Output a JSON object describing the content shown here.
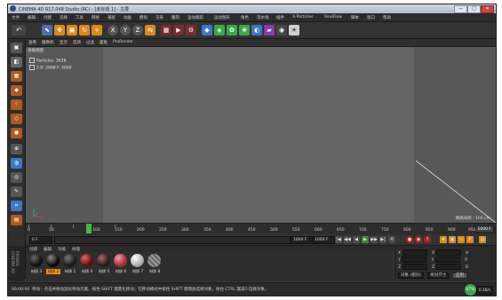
{
  "window": {
    "title": "CINEMA 4D R17.048 Studio (RC) - [未标题 1] - 主要",
    "controls": {
      "minimize": "—",
      "maximize": "□",
      "close": "✕"
    }
  },
  "menubar": [
    "文件",
    "编辑",
    "创建",
    "选择",
    "工具",
    "网格",
    "捕捉",
    "动画",
    "模拟",
    "渲染",
    "雕刻",
    "运动跟踪",
    "运动图形",
    "角色",
    "流水线",
    "插件",
    "X-Particles",
    "RealFlow",
    "脚本",
    "窗口",
    "帮助"
  ],
  "toolbar": {
    "undo": "↶",
    "move": "✥",
    "scale": "▣",
    "rotate": "↻",
    "add": "+",
    "x_axis": "X",
    "y_axis": "Y",
    "z_axis": "Z",
    "coord": "⇆"
  },
  "viewport": {
    "menu": [
      "查看",
      "摄像机",
      "显示",
      "选项",
      "过滤",
      "面板",
      "ProRender"
    ],
    "label": "透视视图",
    "hud": [
      {
        "label": "Particles: 3628"
      },
      {
        "label": "2.0: 2908 F: 5000"
      }
    ],
    "grid_spacing": "网格间距 : 100 cm"
  },
  "timeline": {
    "ticks": [
      "0",
      "50",
      "100",
      "150",
      "200",
      "250",
      "300",
      "350",
      "400",
      "450",
      "500",
      "550",
      "600",
      "650",
      "700",
      "750",
      "800",
      "850",
      "900",
      "950"
    ],
    "current_frame": "100",
    "end_label": "1000 F"
  },
  "transport": {
    "start_field": "0 F",
    "current_field": "0 F",
    "end_field": "1000 F",
    "max_field": "1000 F",
    "buttons": [
      "|◀",
      "◀◀",
      "◀",
      "▶",
      "▶▶",
      "▶|",
      "⟲"
    ]
  },
  "materials": {
    "menu": [
      "创建",
      "编辑",
      "功能",
      "纹理"
    ],
    "items": [
      {
        "label": "材质 3",
        "color": "#111111",
        "selected": false
      },
      {
        "label": "材质 2",
        "color": "#0a0a0a",
        "selected": true
      },
      {
        "label": "材质 1",
        "color": "#1a1a1a",
        "selected": false
      },
      {
        "label": "材质 4",
        "color": "#5a1010",
        "selected": false
      },
      {
        "label": "材质 5",
        "color": "#2a1a1a",
        "selected": false
      },
      {
        "label": "材质 6",
        "color": "#a03030",
        "selected": false
      },
      {
        "label": "材质 7",
        "color": "#b0b0b0",
        "selected": false
      },
      {
        "label": "材质 8",
        "color": "#888888",
        "selected": false
      }
    ]
  },
  "coords": {
    "rows": [
      {
        "a": "X",
        "b": "X",
        "c": "H"
      },
      {
        "a": "Y",
        "b": "Y",
        "c": "P"
      },
      {
        "a": "Z",
        "b": "Z",
        "c": "B"
      }
    ],
    "apply": "应用",
    "mode1": "对象 (相对)",
    "mode2": "绝对尺寸"
  },
  "status": {
    "time": "00:00:00",
    "message": "移动：点击并拖动鼠标移动元素。按住 SHIFT 键量化移动；在移动模式中按住 SHIFT 键增加选择对象；按住 CTRL 键减少选择对象。",
    "badge": "67%",
    "net": "0.1K/s"
  },
  "colors": {
    "accent": "#f39200",
    "playhead": "#3bbf3b",
    "viewport_bg": "#585858",
    "safe_frame": "#646464"
  }
}
